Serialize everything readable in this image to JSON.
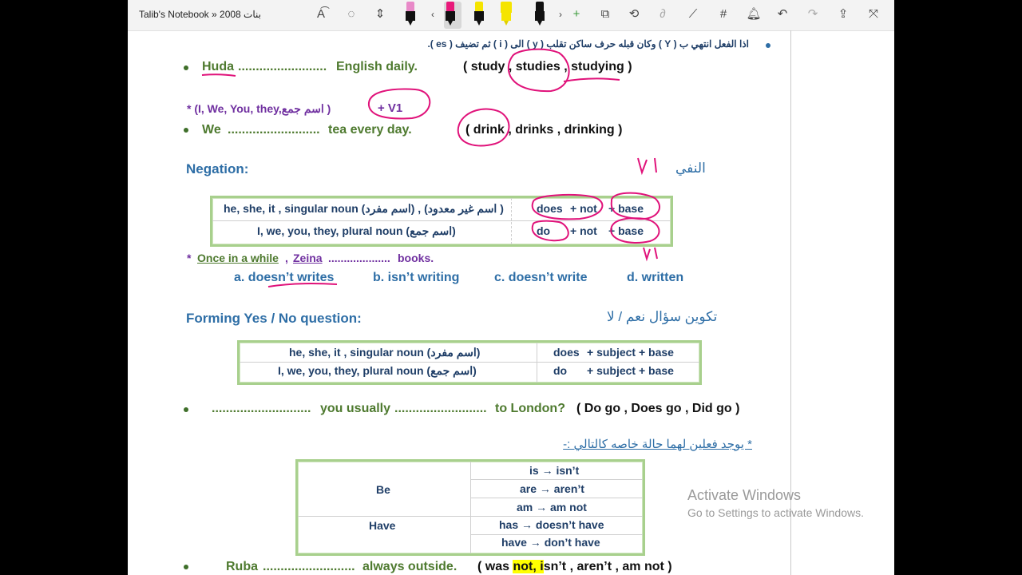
{
  "toolbar": {
    "title": "Talib's Notebook » بنات 2008",
    "pen_colors": [
      "#c71585",
      "#e8197a",
      "#f5e400",
      "#f5e400",
      "#9b59b6"
    ]
  },
  "content": {
    "rule_y": "اذا الفعل انتهي ب ( Y ) وكان قبله حرف ساكن تقلب ( y ) الى ( i ) ثم تضيف ( es ).",
    "q1": {
      "subject": "Huda",
      "blank": ".........................",
      "rest": "English daily.",
      "options": "( study , studies , studying )"
    },
    "plural_rule": "* (I, We, You, they,اسم جمع  )",
    "v1_note": "+ V1",
    "q2": {
      "subject": "We",
      "blank": "..........................",
      "rest": "tea every day.",
      "options": "( drink , drinks , drinking )"
    },
    "negation_heading": "Negation:",
    "negation_arabic": "النفي",
    "negation_table": [
      {
        "subject": "he, she, it , singular noun (اسم مفرد) , (اسم غير معدود )",
        "aux": "does",
        "neg": "+ not",
        "verb": "+ base"
      },
      {
        "subject": "I, we, you, they, plural noun (اسم جمع)",
        "aux": "do",
        "neg": "+ not",
        "verb": "+ base"
      }
    ],
    "q3": {
      "prefix": "*",
      "adverb": "Once in a while",
      "subject": "Zeina",
      "blank": "....................",
      "rest": "books."
    },
    "q3_options": [
      "a. doesn’t writes",
      "b. isn’t writing",
      "c. doesn’t write",
      "d. written"
    ],
    "question_heading": "Forming Yes / No question:",
    "question_arabic": "تكوين سؤال نعم / لا",
    "question_table": [
      {
        "subject": "he, she, it , singular noun (اسم مفرد)",
        "aux": "does",
        "rest": "+ subject  + base"
      },
      {
        "subject": "I, we, you, they, plural noun (اسم جمع)",
        "aux": "do",
        "rest": "+ subject  + base"
      }
    ],
    "q4": {
      "blank1": "............................",
      "middle": "you usually",
      "blank2": "..........................",
      "rest": "to London?",
      "options": "( Do go , Does go , Did go )"
    },
    "special_note": "* يوجد فعلين لهما حالة خاصه كالتالي :-",
    "special_table": {
      "be_label": "Be",
      "have_label": "Have",
      "be_rows": [
        "is → isn’t",
        "are → aren’t",
        "am → am not"
      ],
      "have_rows": [
        "has → doesn’t have",
        "have → don’t have"
      ]
    },
    "q5": {
      "subject": "Ruba",
      "blank": "..........................",
      "rest": "always outside.",
      "options_pre": "( was ",
      "options_hl": "not, i",
      "options_post": "sn’t , aren’t , am not )"
    }
  },
  "ink": {
    "v1_a": "V1",
    "v1_b": "V1"
  },
  "watermark": {
    "line1": "Activate Windows",
    "line2": "Go to Settings to activate Windows."
  }
}
